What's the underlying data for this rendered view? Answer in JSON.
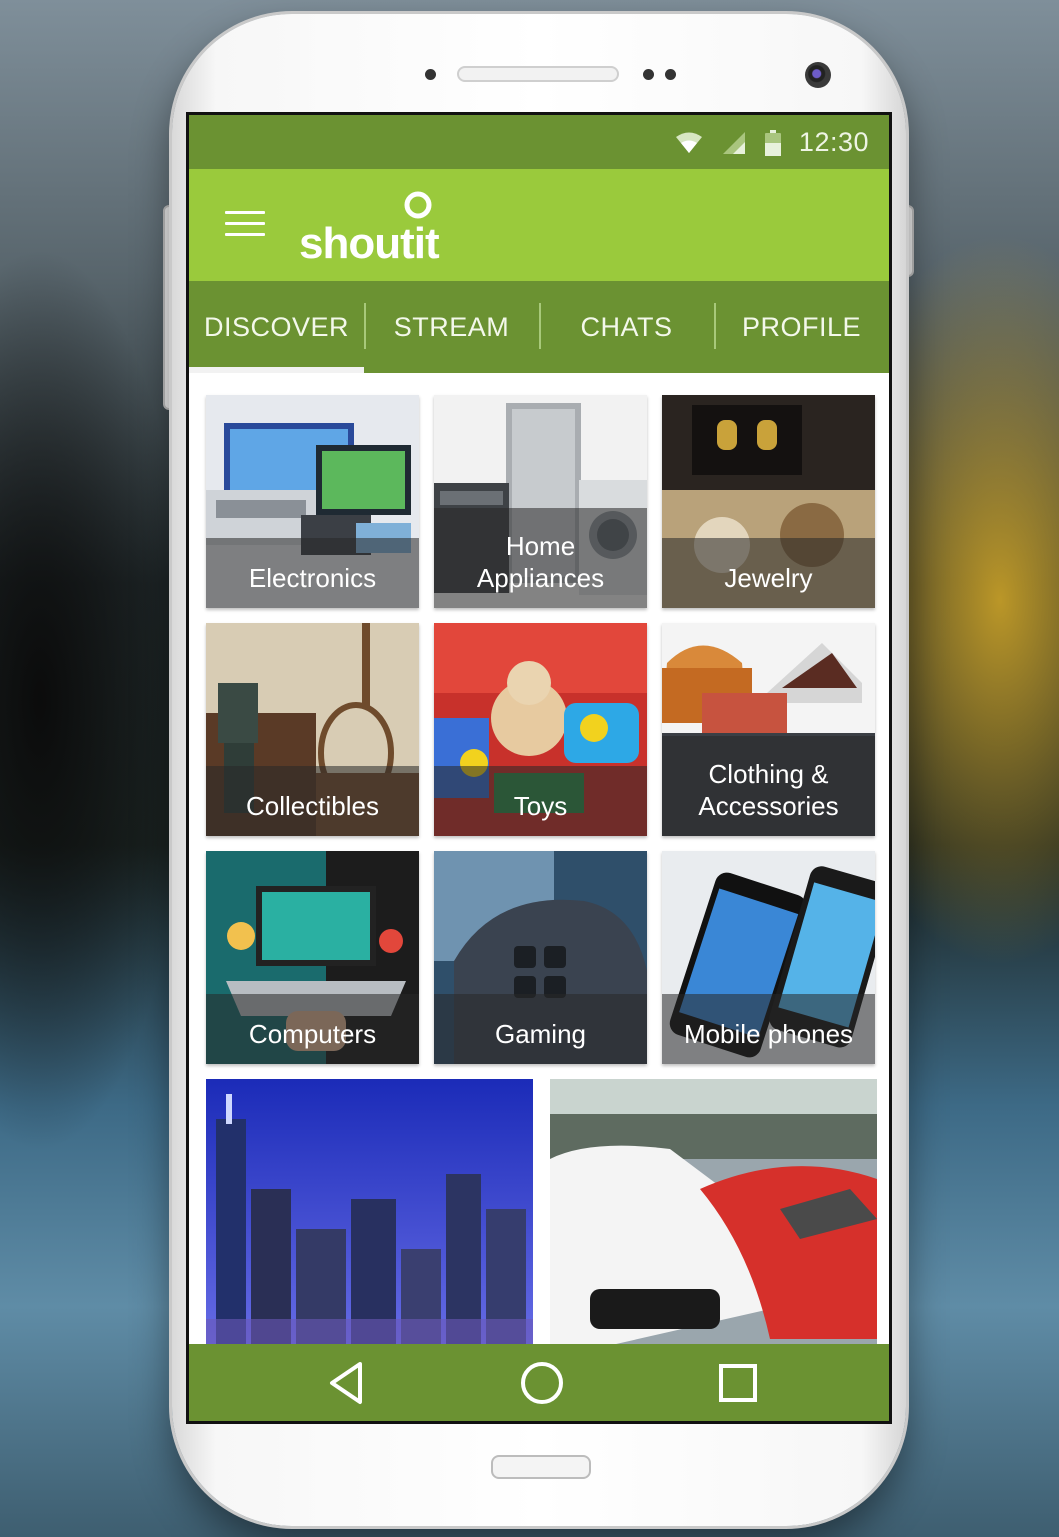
{
  "status_bar": {
    "time": "12:30",
    "icons": [
      "wifi-icon",
      "cellular-signal-icon",
      "battery-icon"
    ]
  },
  "app_bar": {
    "menu_icon": "hamburger-menu-icon",
    "logo_text": "shoutit",
    "logo_icon": "location-pin-icon"
  },
  "tabs": [
    {
      "label": "DISCOVER",
      "active": true
    },
    {
      "label": "STREAM",
      "active": false
    },
    {
      "label": "CHATS",
      "active": false
    },
    {
      "label": "PROFILE",
      "active": false
    }
  ],
  "categories": [
    {
      "label": "Electronics"
    },
    {
      "label": "Home Appliances"
    },
    {
      "label": "Jewelry"
    },
    {
      "label": "Collectibles"
    },
    {
      "label": "Toys"
    },
    {
      "label": "Clothing & Accessories"
    },
    {
      "label": "Computers"
    },
    {
      "label": "Gaming"
    },
    {
      "label": "Mobile phones"
    }
  ],
  "featured_images": [
    "city-skyline-night-image",
    "sports-cars-lot-image"
  ],
  "nav_bar": {
    "back_icon": "back-triangle-icon",
    "home_icon": "home-circle-icon",
    "recents_icon": "recents-square-icon"
  },
  "colors": {
    "status_bar": "#6b9232",
    "app_bar": "#9aca3c",
    "tab_bar": "#6b9232",
    "nav_bar": "#6b9232"
  }
}
